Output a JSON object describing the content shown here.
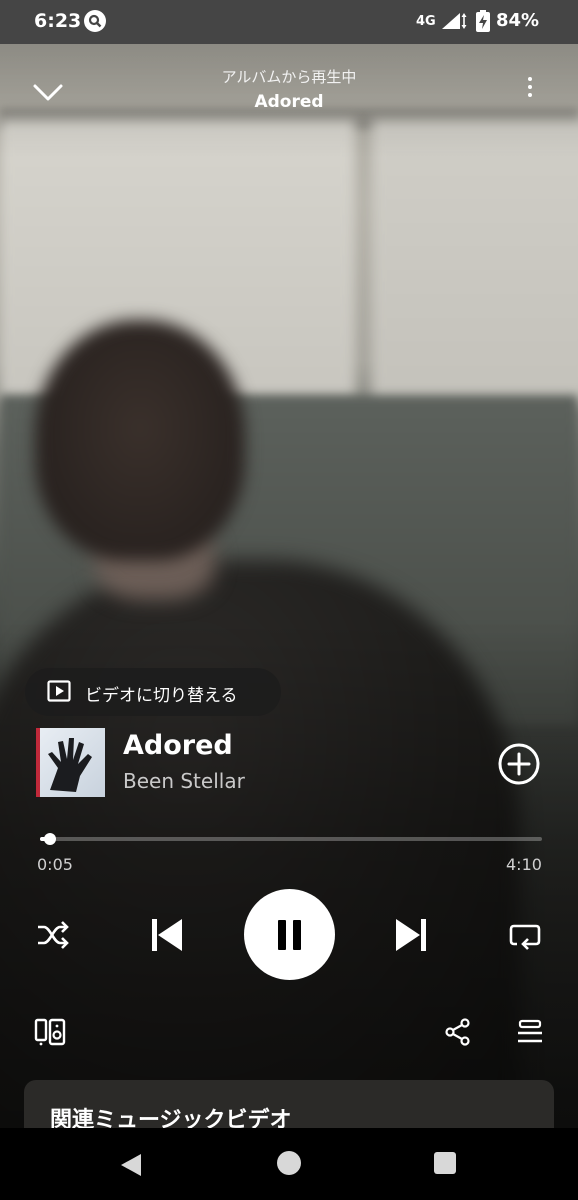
{
  "status_bar": {
    "time": "6:23",
    "network": "4G",
    "battery_pct": "84%"
  },
  "header": {
    "context_label": "アルバムから再生中",
    "album_title": "Adored"
  },
  "video_switch": {
    "label": "ビデオに切り替える"
  },
  "track": {
    "title": "Adored",
    "artist": "Been Stellar"
  },
  "progress": {
    "current_time": "0:05",
    "total_time": "4:10",
    "fraction": 0.02
  },
  "related": {
    "title": "関連ミュージックビデオ"
  },
  "icons": {
    "collapse": "chevron-down-icon",
    "more": "more-vertical-icon",
    "video": "play-square-icon",
    "add": "plus-circle-icon",
    "shuffle": "shuffle-icon",
    "previous": "skip-previous-icon",
    "pause": "pause-icon",
    "next": "skip-next-icon",
    "repeat": "repeat-icon",
    "devices": "connect-device-icon",
    "share": "share-icon",
    "queue": "queue-icon"
  },
  "colors": {
    "accent_red": "#c0293a",
    "status_bar": "#454545",
    "card": "#2b2a28"
  }
}
